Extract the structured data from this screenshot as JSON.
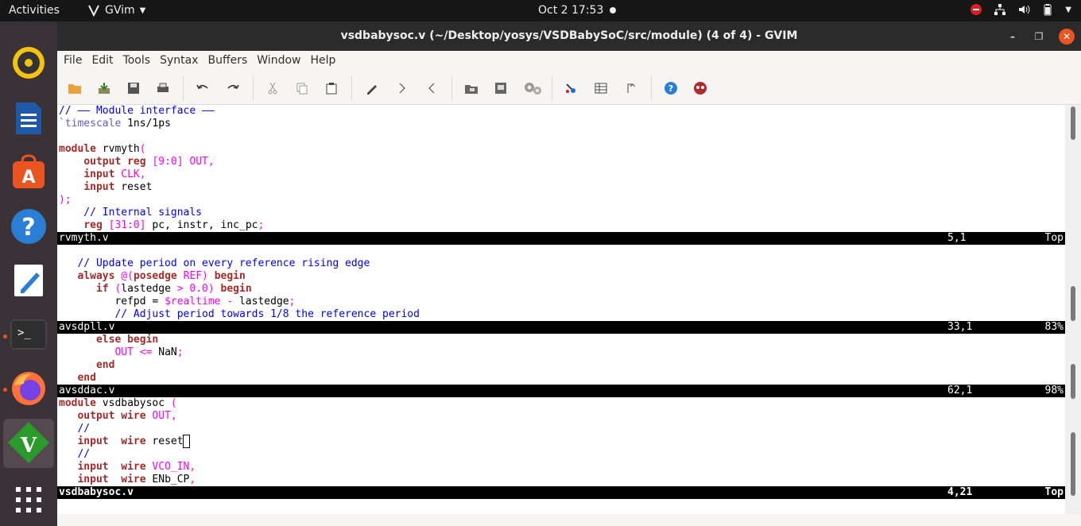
{
  "topbar": {
    "activities": "Activities",
    "app_name": "GVim",
    "clock": "Oct 2  17:53"
  },
  "dock": {
    "items": [
      "rhythmbox-icon",
      "libreoffice-writer-icon",
      "software-center-icon",
      "help-icon",
      "text-editor-icon",
      "terminal-icon",
      "firefox-icon",
      "gvim-icon",
      "app-grid-icon"
    ]
  },
  "window": {
    "title": "vsdbabysoc.v (~/Desktop/yosys/VSDBabySoC/src/module) (4 of 4) - GVIM",
    "menus": [
      "File",
      "Edit",
      "Tools",
      "Syntax",
      "Buffers",
      "Window",
      "Help"
    ]
  },
  "panes": {
    "p1": {
      "lines": [
        "// —— Module interface ——",
        "`timescale 1ns/1ps",
        "",
        "module rvmyth(",
        "    output reg [9:0] OUT,",
        "    input CLK,",
        "    input reset",
        ");",
        "    // Internal signals",
        "    reg [31:0] pc, instr, inc_pc;"
      ],
      "file": "rvmyth.v",
      "pos": "5,1",
      "pct": "Top"
    },
    "p2": {
      "lines": [
        "",
        "   // Update period on every reference rising edge",
        "   always @(posedge REF) begin",
        "      if (lastedge > 0.0) begin",
        "         refpd = $realtime - lastedge;",
        "         // Adjust period towards 1/8 the reference period"
      ],
      "file": "avsdpll.v",
      "pos": "33,1",
      "pct": "83%"
    },
    "p3": {
      "lines": [
        "      else begin",
        "         OUT <= NaN;",
        "      end",
        "   end"
      ],
      "file": "avsddac.v",
      "pos": "62,1",
      "pct": "98%"
    },
    "p4": {
      "lines": [
        "module vsdbabysoc (",
        "   output wire OUT,",
        "   //",
        "   input  wire reset",
        "   //",
        "   input  wire VCO_IN,",
        "   input  wire ENb_CP,"
      ],
      "file": "vsdbabysoc.v",
      "pos": "4,21",
      "pct": "Top"
    }
  }
}
